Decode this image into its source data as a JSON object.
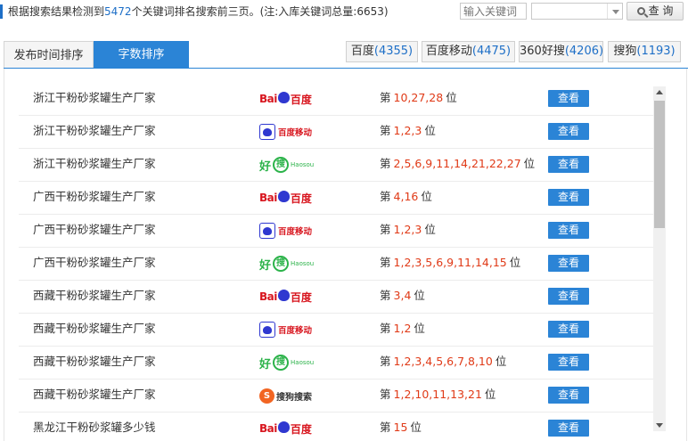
{
  "summary": {
    "prefix": "根据搜索结果检测到",
    "count": "5472",
    "suffix": "个关键词排名搜索前三页。(注:入库关键词总量:6653)"
  },
  "search": {
    "placeholder": "输入关键词",
    "select_value": "",
    "query_label": "查 询"
  },
  "tabs": [
    {
      "label": "发布时间排序"
    },
    {
      "label": "字数排序"
    }
  ],
  "engine_tabs": [
    {
      "label": "百度",
      "count": "(4355)"
    },
    {
      "label": "百度移动",
      "count": "(4475)"
    },
    {
      "label": "360好搜",
      "count": "(4206)"
    },
    {
      "label": "搜狗",
      "count": "(1193)"
    }
  ],
  "logos": {
    "baidu": {
      "bai": "Bai",
      "du": "百度"
    },
    "baidu_mobile": {
      "text": "百度移动"
    },
    "haosou": {
      "hao": "好",
      "sou": "搜",
      "en": "Haosou"
    },
    "sogou": {
      "s": "S",
      "text": "搜狗搜索"
    }
  },
  "rank_prefix": "第",
  "rank_suffix": "位",
  "view_label": "查看",
  "rows": [
    {
      "keyword": "浙江干粉砂浆罐生产厂家",
      "engine": "baidu",
      "ranks": "10,27,28"
    },
    {
      "keyword": "浙江干粉砂浆罐生产厂家",
      "engine": "baidu_mobile",
      "ranks": "1,2,3"
    },
    {
      "keyword": "浙江干粉砂浆罐生产厂家",
      "engine": "haosou",
      "ranks": "2,5,6,9,11,14,21,22,27"
    },
    {
      "keyword": "广西干粉砂浆罐生产厂家",
      "engine": "baidu",
      "ranks": "4,16"
    },
    {
      "keyword": "广西干粉砂浆罐生产厂家",
      "engine": "baidu_mobile",
      "ranks": "1,2,3"
    },
    {
      "keyword": "广西干粉砂浆罐生产厂家",
      "engine": "haosou",
      "ranks": "1,2,3,5,6,9,11,14,15"
    },
    {
      "keyword": "西藏干粉砂浆罐生产厂家",
      "engine": "baidu",
      "ranks": "3,4"
    },
    {
      "keyword": "西藏干粉砂浆罐生产厂家",
      "engine": "baidu_mobile",
      "ranks": "1,2"
    },
    {
      "keyword": "西藏干粉砂浆罐生产厂家",
      "engine": "haosou",
      "ranks": "1,2,3,4,5,6,7,8,10"
    },
    {
      "keyword": "西藏干粉砂浆罐生产厂家",
      "engine": "sogou",
      "ranks": "1,2,10,11,13,21"
    },
    {
      "keyword": "黑龙江干粉砂浆罐多少钱",
      "engine": "baidu",
      "ranks": "15"
    }
  ]
}
